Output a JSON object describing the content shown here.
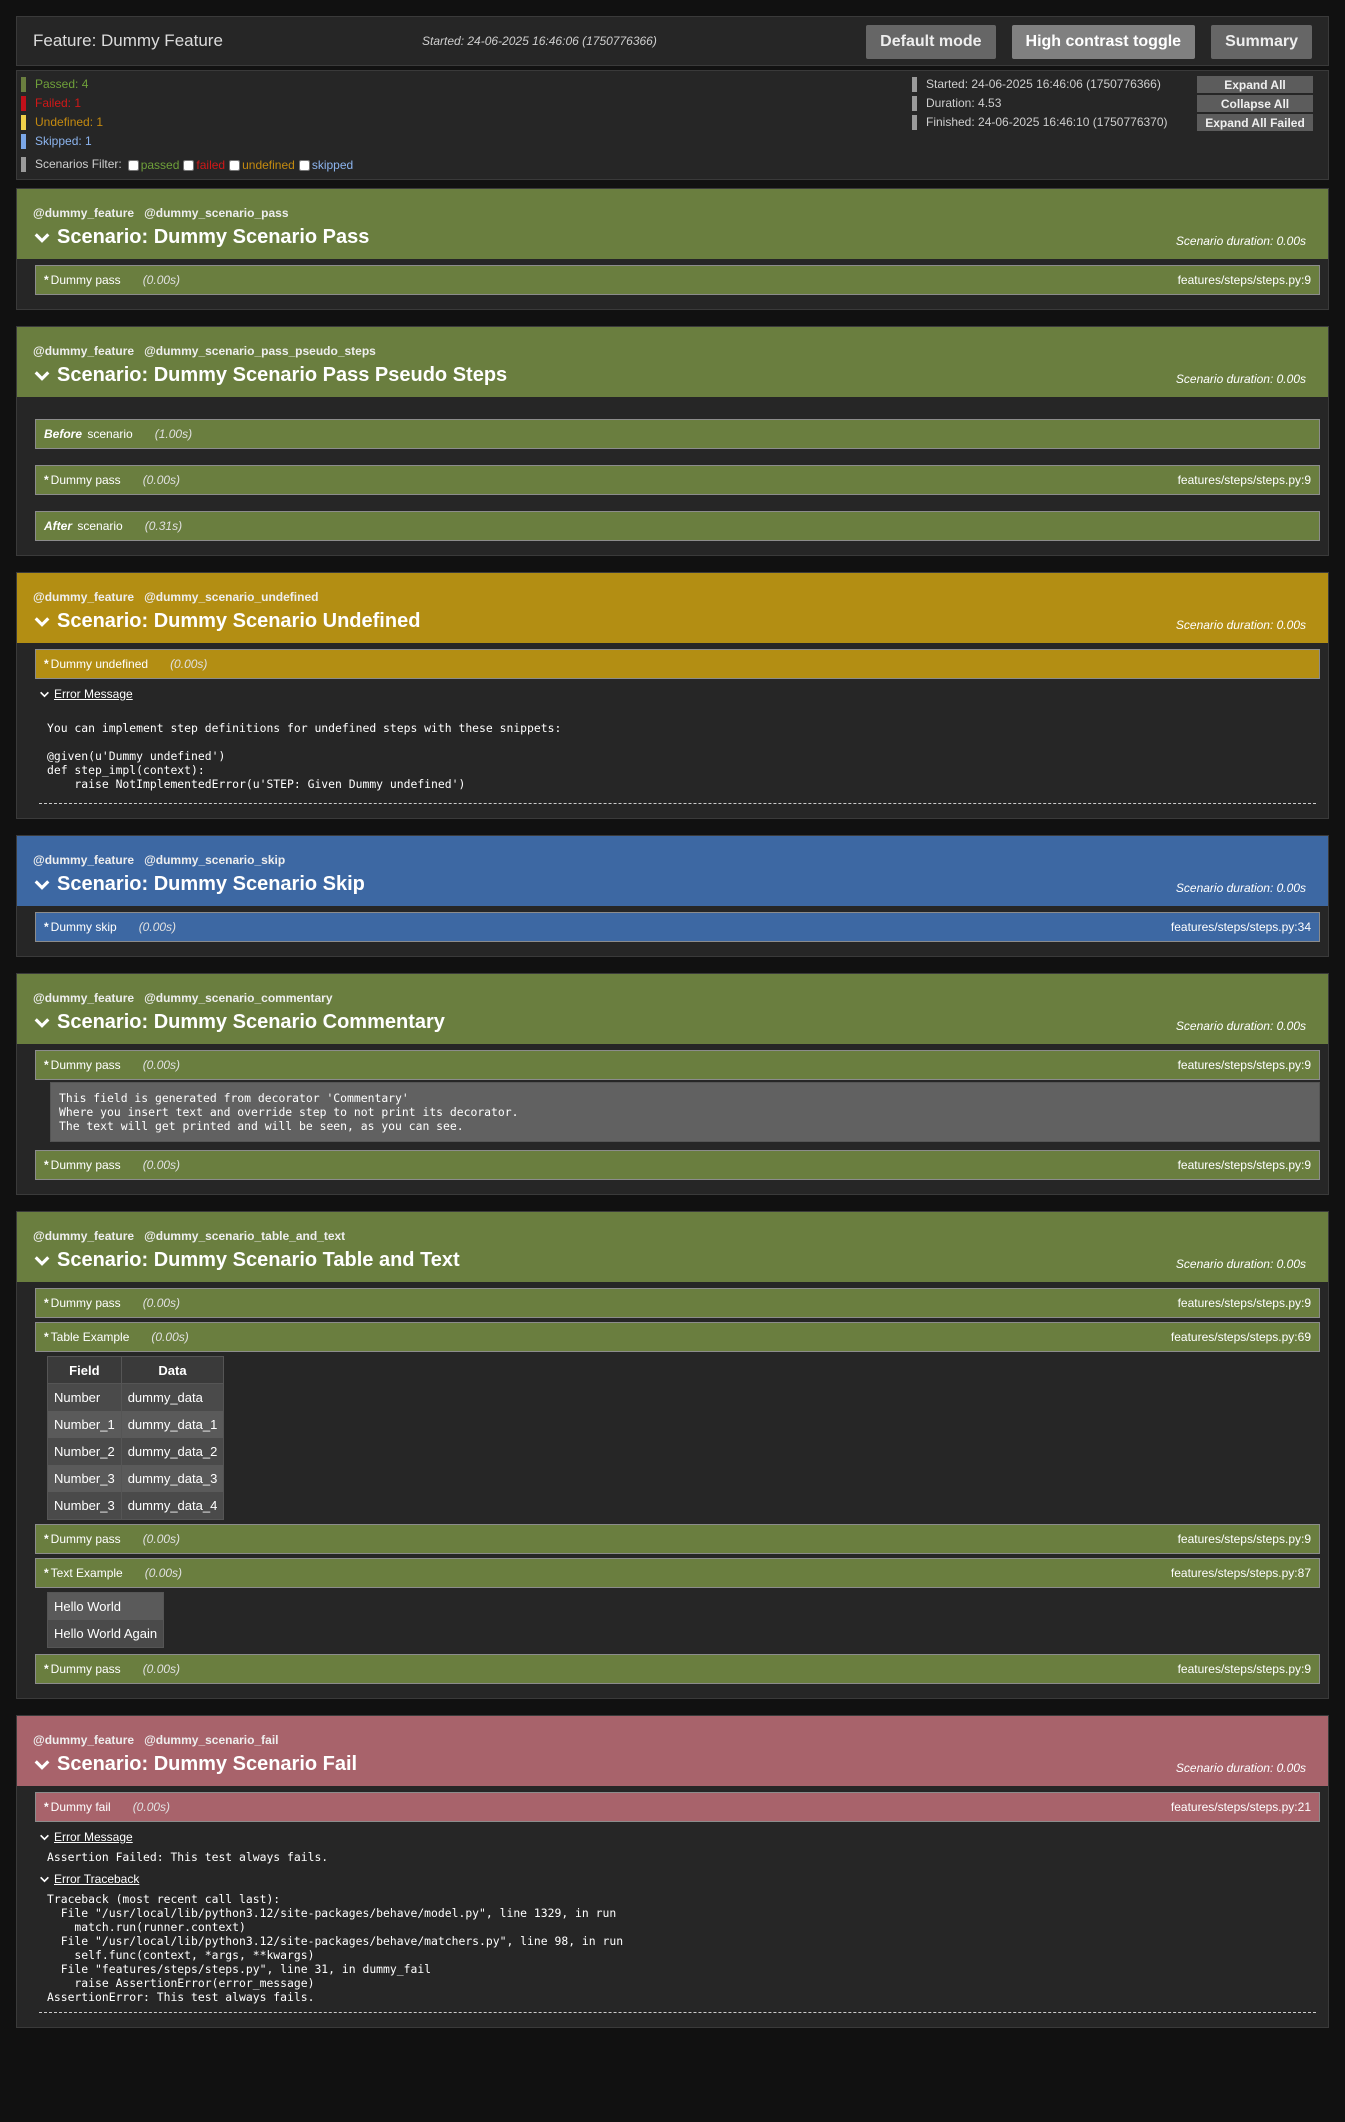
{
  "header": {
    "title": "Feature: Dummy Feature",
    "started": "Started: 24-06-2025 16:46:06 (1750776366)",
    "buttons": {
      "default": "Default mode",
      "contrast": "High contrast toggle",
      "summary": "Summary"
    }
  },
  "summary": {
    "passed": "Passed: 4",
    "failed": "Failed: 1",
    "undefined": "Undefined: 1",
    "skipped": "Skipped: 1",
    "filter_label": "Scenarios Filter:",
    "filters": [
      "passed",
      "failed",
      "undefined",
      "skipped"
    ],
    "started": "Started: 24-06-2025 16:46:06 (1750776366)",
    "duration": "Duration: 4.53",
    "finished": "Finished: 24-06-2025 16:46:10 (1750776370)",
    "buttons": {
      "expand": "Expand All",
      "collapse": "Collapse All",
      "expand_failed": "Expand All Failed"
    }
  },
  "colors": {
    "passed": "#6a7e3f",
    "failed": "#a8636b",
    "undefined": "#b38e13",
    "skipped": "#3d68a3"
  },
  "scenarios": [
    {
      "tag1": "@dummy_feature",
      "tag2": "@dummy_scenario_pass",
      "title": "Scenario: Dummy Scenario Pass",
      "duration": "Scenario duration: 0.00s",
      "steps": [
        {
          "kw": "*",
          "name": "Dummy pass",
          "dur": "(0.00s)",
          "loc": "features/steps/steps.py:9"
        }
      ]
    },
    {
      "tag1": "@dummy_feature",
      "tag2": "@dummy_scenario_pass_pseudo_steps",
      "title": "Scenario: Dummy Scenario Pass Pseudo Steps",
      "duration": "Scenario duration: 0.00s",
      "steps": [
        {
          "kw": "Before",
          "name": "scenario",
          "dur": "(1.00s)"
        },
        {
          "kw": "*",
          "name": "Dummy pass",
          "dur": "(0.00s)",
          "loc": "features/steps/steps.py:9"
        },
        {
          "kw": "After",
          "name": "scenario",
          "dur": "(0.31s)"
        }
      ]
    },
    {
      "tag1": "@dummy_feature",
      "tag2": "@dummy_scenario_undefined",
      "title": "Scenario: Dummy Scenario Undefined",
      "duration": "Scenario duration: 0.00s",
      "steps": [
        {
          "kw": "*",
          "name": "Dummy undefined",
          "dur": "(0.00s)"
        }
      ],
      "error_label": "Error Message",
      "error_text": "You can implement step definitions for undefined steps with these snippets:\n\n@given(u'Dummy undefined')\ndef step_impl(context):\n    raise NotImplementedError(u'STEP: Given Dummy undefined')"
    },
    {
      "tag1": "@dummy_feature",
      "tag2": "@dummy_scenario_skip",
      "title": "Scenario: Dummy Scenario Skip",
      "duration": "Scenario duration: 0.00s",
      "steps": [
        {
          "kw": "*",
          "name": "Dummy skip",
          "dur": "(0.00s)",
          "loc": "features/steps/steps.py:34"
        }
      ]
    },
    {
      "tag1": "@dummy_feature",
      "tag2": "@dummy_scenario_commentary",
      "title": "Scenario: Dummy Scenario Commentary",
      "duration": "Scenario duration: 0.00s",
      "steps": [
        {
          "kw": "*",
          "name": "Dummy pass",
          "dur": "(0.00s)",
          "loc": "features/steps/steps.py:9"
        },
        {
          "kw": "*",
          "name": "Dummy pass",
          "dur": "(0.00s)",
          "loc": "features/steps/steps.py:9"
        }
      ],
      "comment": "This field is generated from decorator 'Commentary'\nWhere you insert text and override step to not print its decorator.\nThe text will get printed and will be seen, as you can see."
    },
    {
      "tag1": "@dummy_feature",
      "tag2": "@dummy_scenario_table_and_text",
      "title": "Scenario: Dummy Scenario Table and Text",
      "duration": "Scenario duration: 0.00s",
      "steps": [
        {
          "kw": "*",
          "name": "Dummy pass",
          "dur": "(0.00s)",
          "loc": "features/steps/steps.py:9"
        },
        {
          "kw": "*",
          "name": "Table Example",
          "dur": "(0.00s)",
          "loc": "features/steps/steps.py:69"
        },
        {
          "kw": "*",
          "name": "Dummy pass",
          "dur": "(0.00s)",
          "loc": "features/steps/steps.py:9"
        },
        {
          "kw": "*",
          "name": "Text Example",
          "dur": "(0.00s)",
          "loc": "features/steps/steps.py:87"
        },
        {
          "kw": "*",
          "name": "Dummy pass",
          "dur": "(0.00s)",
          "loc": "features/steps/steps.py:9"
        }
      ],
      "table": {
        "headers": [
          "Field",
          "Data"
        ],
        "rows": [
          [
            "Number",
            "dummy_data"
          ],
          [
            "Number_1",
            "dummy_data_1"
          ],
          [
            "Number_2",
            "dummy_data_2"
          ],
          [
            "Number_3",
            "dummy_data_3"
          ],
          [
            "Number_3",
            "dummy_data_4"
          ]
        ]
      },
      "text_lines": [
        "Hello World",
        "Hello World Again"
      ]
    },
    {
      "tag1": "@dummy_feature",
      "tag2": "@dummy_scenario_fail",
      "title": "Scenario: Dummy Scenario Fail",
      "duration": "Scenario duration: 0.00s",
      "steps": [
        {
          "kw": "*",
          "name": "Dummy fail",
          "dur": "(0.00s)",
          "loc": "features/steps/steps.py:21"
        }
      ],
      "error_label": "Error Message",
      "error_text": "Assertion Failed: This test always fails.",
      "traceback_label": "Error Traceback",
      "traceback_text": "Traceback (most recent call last):\n  File \"/usr/local/lib/python3.12/site-packages/behave/model.py\", line 1329, in run\n    match.run(runner.context)\n  File \"/usr/local/lib/python3.12/site-packages/behave/matchers.py\", line 98, in run\n    self.func(context, *args, **kwargs)\n  File \"features/steps/steps.py\", line 31, in dummy_fail\n    raise AssertionError(error_message)\nAssertionError: This test always fails."
    }
  ]
}
